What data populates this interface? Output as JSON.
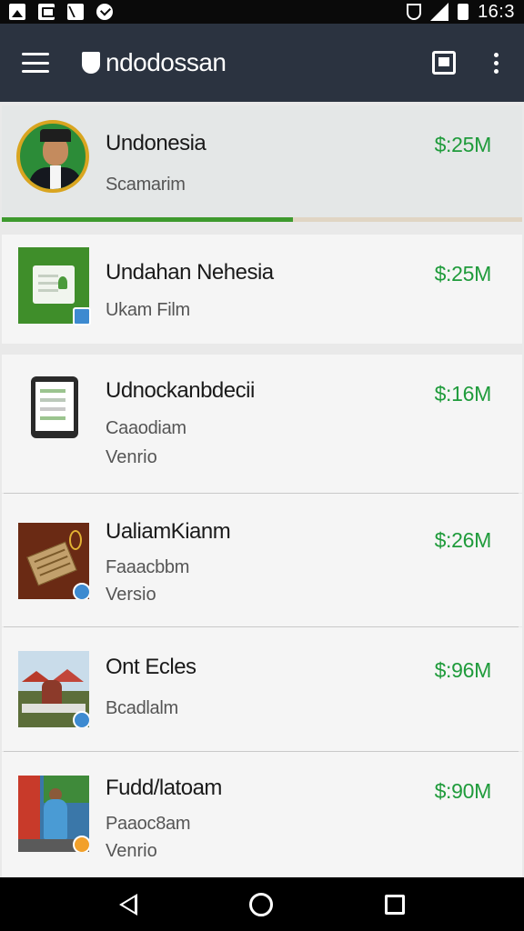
{
  "status_bar": {
    "time": "16:3",
    "icons": [
      "image-icon",
      "photo-icon",
      "n-box-icon",
      "check-circle-icon",
      "shield-icon",
      "signal-icon",
      "battery-icon"
    ]
  },
  "app_bar": {
    "title": "ndodossan",
    "icons": [
      "menu-icon",
      "shield-logo-icon",
      "bookmark-icon",
      "more-vert-icon"
    ]
  },
  "items": [
    {
      "title": "Undonesia",
      "subtitle": "Scamarim",
      "subtitle2": "",
      "price": "$:25M",
      "thumb": "avatar",
      "selected": true,
      "progress": 0.56
    },
    {
      "title": "Undahan Nehesia",
      "subtitle": "Ukam Film",
      "subtitle2": "",
      "price": "$:25M",
      "thumb": "green-card",
      "selected": false
    },
    {
      "title": "Udnockanbdecii",
      "subtitle": "Caaodiam",
      "subtitle2": "Venrio",
      "price": "$:16M",
      "thumb": "tablet",
      "selected": false
    },
    {
      "title": "UaliamKianm",
      "subtitle": "Faaacbbm",
      "subtitle2": "Versio",
      "price": "$:26M",
      "thumb": "wood",
      "selected": false
    },
    {
      "title": "Ont Ecles",
      "subtitle": "Bcadlalm",
      "subtitle2": "",
      "price": "$:96M",
      "thumb": "scene",
      "selected": false
    },
    {
      "title": "Fudd/latoam",
      "subtitle": "Paaoc8am",
      "subtitle2": "Venrio",
      "price": "$:90M",
      "thumb": "street",
      "selected": false
    }
  ],
  "colors": {
    "app_bar": "#2b3340",
    "price": "#1f9b3b",
    "progress_fill": "#3e9a2e",
    "progress_track": "#e0d5c4"
  },
  "nav_bar": {
    "icons": [
      "back-icon",
      "home-icon",
      "recents-icon"
    ]
  }
}
